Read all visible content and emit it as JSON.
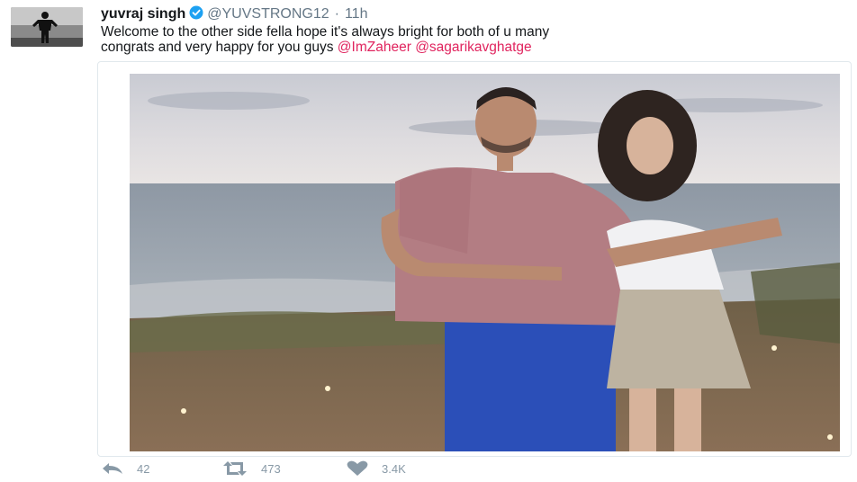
{
  "tweet": {
    "author_name": "yuvraj singh",
    "handle": "@YUVSTRONG12",
    "separator": "·",
    "time": "11h",
    "text_line1": "Welcome to the other side fella hope it's always bright for both of u many",
    "text_line2": "congrats and very happy for you guys",
    "mention1": "@ImZaheer",
    "mention2": "@sagarikavghatge"
  },
  "actions": {
    "reply_count": "42",
    "retweet_count": "473",
    "like_count": "3.4K"
  },
  "colors": {
    "mention": "#e0245e",
    "verified": "#1da1f2",
    "action_gray": "#8899a6"
  },
  "icons": [
    "verified-badge-icon",
    "reply-icon",
    "retweet-icon",
    "like-icon"
  ]
}
